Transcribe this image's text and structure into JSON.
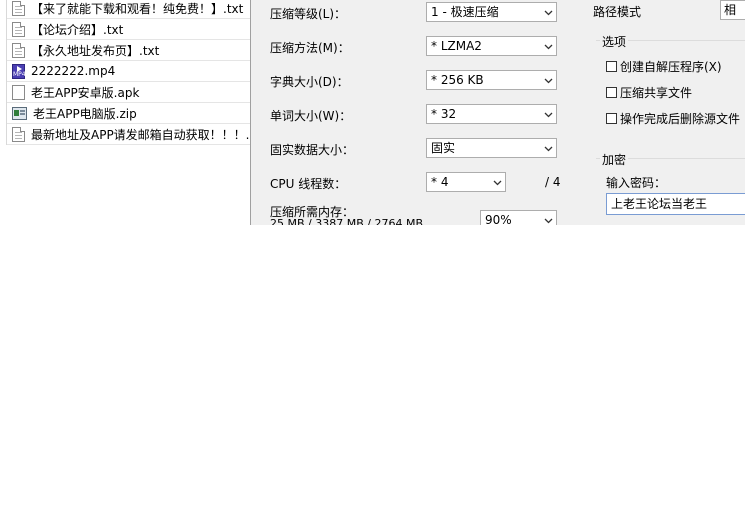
{
  "files": [
    {
      "name": "【来了就能下载和观看！纯免费！】.txt",
      "icon": "txt-file-icon"
    },
    {
      "name": "【论坛介绍】.txt",
      "icon": "txt-file-icon"
    },
    {
      "name": "【永久地址发布页】.txt",
      "icon": "txt-file-icon"
    },
    {
      "name": "2222222.mp4",
      "icon": "mp4-file-icon"
    },
    {
      "name": "老王APP安卓版.apk",
      "icon": "apk-file-icon"
    },
    {
      "name": "老王APP电脑版.zip",
      "icon": "zip-file-icon"
    },
    {
      "name": "最新地址及APP请发邮箱自动获取！！！..",
      "icon": "txt-file-icon"
    }
  ],
  "compression": {
    "level_label": "压缩等级(L)：",
    "level_value": "1 - 极速压缩",
    "method_label": "压缩方法(M)：",
    "method_value": "* LZMA2",
    "dict_label": "字典大小(D)：",
    "dict_value": "* 256 KB",
    "word_label": "单词大小(W)：",
    "word_value": "* 32",
    "solid_label": "固实数据大小：",
    "solid_value": "固实",
    "cpu_label": "CPU 线程数：",
    "cpu_value": "* 4",
    "cpu_total": "/ 4",
    "memory_label": "压缩所需内存：",
    "memory_values": "25 MB / 3387 MB / 2764 MB",
    "memory_percent": "90%"
  },
  "path": {
    "label": "路径模式",
    "value": "相对"
  },
  "options": {
    "title": "选项",
    "sfx": "创建自解压程序(X)",
    "shared": "压缩共享文件",
    "delete_after": "操作完成后删除源文件"
  },
  "encryption": {
    "title": "加密",
    "password_label": "输入密码：",
    "password_value": "上老王论坛当老王"
  }
}
